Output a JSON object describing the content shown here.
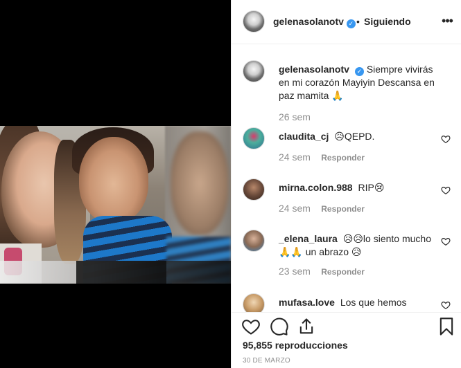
{
  "header": {
    "username": "gelenasolanotv",
    "separator": "•",
    "follow_status": "Siguiendo",
    "more": "•••"
  },
  "caption": {
    "username": "gelenasolanotv",
    "text": "Siempre vivirás en mi corazón Mayiyin Descansa en paz mamita 🙏",
    "time": "26 sem"
  },
  "comments": [
    {
      "username": "claudita_cj",
      "text": "😥QEPD.",
      "time": "24 sem",
      "reply": "Responder"
    },
    {
      "username": "mirna.colon.988",
      "text": "RIP😢",
      "time": "24 sem",
      "reply": "Responder"
    },
    {
      "username": "_elena_laura",
      "text": "😥😥lo siento mucho 🙏🙏 un abrazo 😥",
      "time": "23 sem",
      "reply": "Responder"
    },
    {
      "username": "mufasa.love",
      "text": "Los que hemos"
    }
  ],
  "footer": {
    "views": "95,855 reproducciones",
    "date": "30 DE MARZO"
  },
  "icons": {
    "like": "heart-icon",
    "comment": "comment-icon",
    "share": "share-icon",
    "save": "bookmark-icon"
  },
  "colors": {
    "verified": "#3897f0",
    "text": "#262626",
    "muted": "#8e8e8e"
  }
}
